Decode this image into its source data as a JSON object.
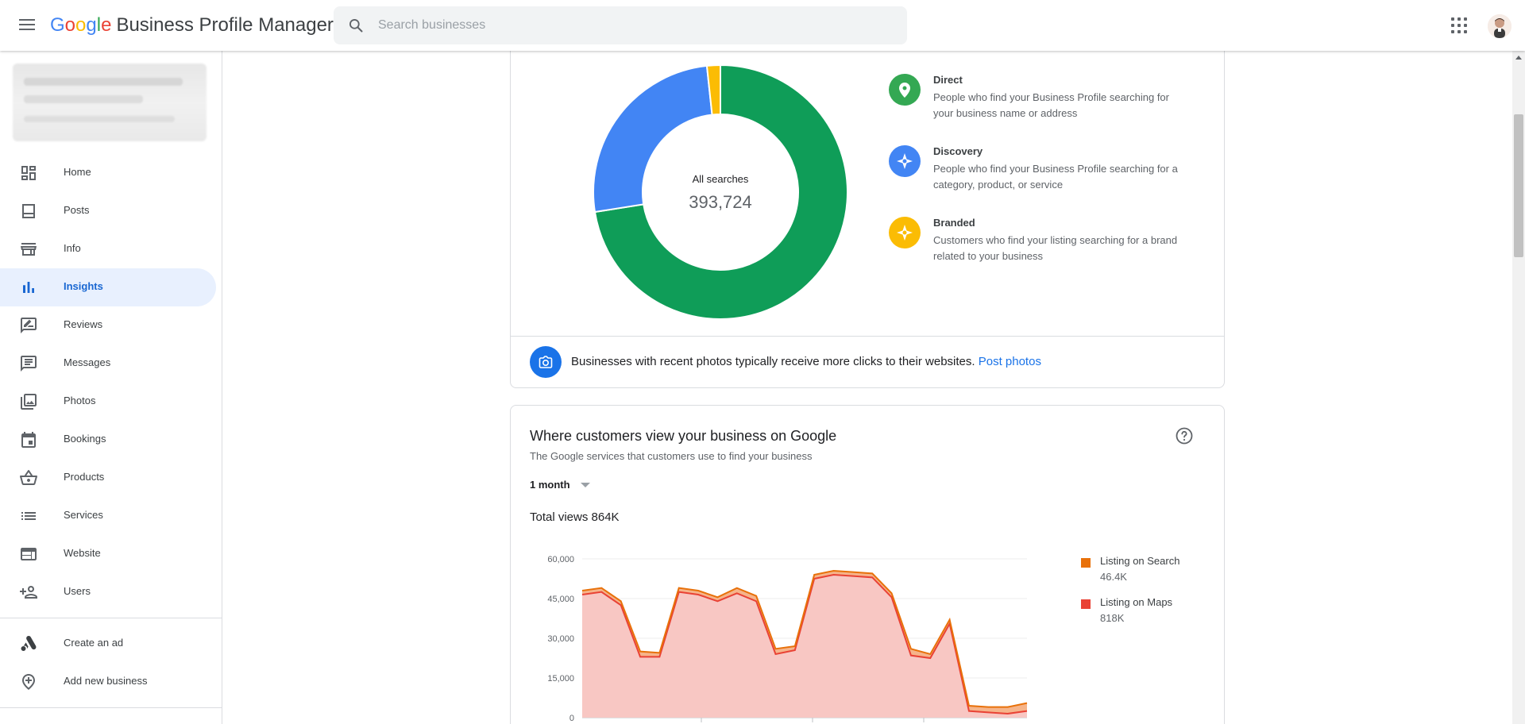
{
  "topbar": {
    "brand_g": [
      "G",
      "o",
      "o",
      "g",
      "l",
      "e"
    ],
    "brand_rest": "Business Profile Manager",
    "search_placeholder": "Search businesses"
  },
  "sidebar": {
    "items": [
      {
        "label": "Home",
        "icon": "dashboard-icon"
      },
      {
        "label": "Posts",
        "icon": "posts-icon"
      },
      {
        "label": "Info",
        "icon": "storefront-icon"
      },
      {
        "label": "Insights",
        "icon": "bar-chart-icon",
        "active": true
      },
      {
        "label": "Reviews",
        "icon": "rate-review-icon"
      },
      {
        "label": "Messages",
        "icon": "chat-icon"
      },
      {
        "label": "Photos",
        "icon": "photo-library-icon"
      },
      {
        "label": "Bookings",
        "icon": "calendar-icon"
      },
      {
        "label": "Products",
        "icon": "basket-icon"
      },
      {
        "label": "Services",
        "icon": "list-icon"
      },
      {
        "label": "Website",
        "icon": "web-icon"
      },
      {
        "label": "Users",
        "icon": "person-add-icon"
      }
    ],
    "extra": [
      {
        "label": "Create an ad",
        "icon": "google-ads-icon"
      },
      {
        "label": "Add new business",
        "icon": "add-location-icon"
      }
    ]
  },
  "searches_card": {
    "center_label": "All searches",
    "center_value": "393,724",
    "legend": [
      {
        "title": "Direct",
        "desc": "People who find your Business Profile searching for your business name or address",
        "color": "#34a853",
        "icon": "location-pin-icon"
      },
      {
        "title": "Discovery",
        "desc": "People who find your Business Profile searching for a category, product, or service",
        "color": "#4285f4",
        "icon": "compass-icon"
      },
      {
        "title": "Branded",
        "desc": "Customers who find your listing searching for a brand related to your business",
        "color": "#fbbc04",
        "icon": "compass-icon"
      }
    ],
    "tip_text": "Businesses with recent photos typically receive more clicks to their websites.",
    "tip_link": "Post photos"
  },
  "views_card": {
    "title": "Where customers view your business on Google",
    "subtitle": "The Google services that customers use to find your business",
    "period": "1 month",
    "total": "Total views 864K",
    "legend": [
      {
        "name": "Listing on Search",
        "value": "46.4K",
        "color": "#e8710a"
      },
      {
        "name": "Listing on Maps",
        "value": "818K",
        "color": "#e94235"
      }
    ]
  },
  "chart_data": [
    {
      "type": "pie",
      "labels": [
        "Direct",
        "Discovery",
        "Branded"
      ],
      "values": [
        72.5,
        25.8,
        1.7
      ],
      "colors": [
        "#0f9d58",
        "#4285f4",
        "#fbbc04"
      ]
    },
    {
      "type": "area",
      "series": [
        {
          "name": "Listing on Maps",
          "color": "#e94235",
          "values": [
            46500,
            47500,
            42500,
            23000,
            23000,
            47500,
            46500,
            44000,
            47000,
            44000,
            24000,
            25500,
            52500,
            54000,
            53500,
            53000,
            45500,
            23500,
            22500,
            35500,
            2500,
            2000,
            1500,
            2500
          ]
        },
        {
          "name": "Listing on Search",
          "color": "#e8710a",
          "values": [
            1500,
            1500,
            1500,
            2000,
            1500,
            1500,
            1500,
            1500,
            2000,
            2000,
            2000,
            1500,
            1500,
            1500,
            1500,
            1500,
            1500,
            2500,
            1500,
            1500,
            2000,
            2000,
            2500,
            3000
          ]
        }
      ],
      "yticks": [
        "60,000",
        "45,000",
        "30,000",
        "15,000",
        "0"
      ],
      "ylim": [
        0,
        60000
      ]
    }
  ]
}
